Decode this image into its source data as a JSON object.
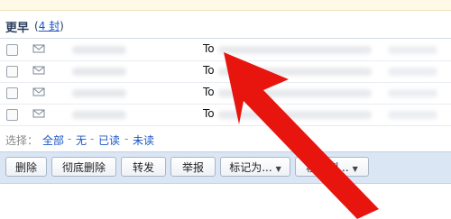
{
  "section": {
    "title": "更早",
    "count_open": "(",
    "count_link": "4 封",
    "count_close": ")"
  },
  "rows": [
    {
      "subject_prefix": "To"
    },
    {
      "subject_prefix": "To"
    },
    {
      "subject_prefix": "To"
    },
    {
      "subject_prefix": "To"
    }
  ],
  "select_bar": {
    "label": "选择：",
    "all": "全部",
    "none": "无",
    "read": "已读",
    "unread": "未读",
    "sep": "-"
  },
  "toolbar": {
    "delete": "删除",
    "delete_permanently": "彻底删除",
    "forward": "转发",
    "report": "举报",
    "mark_as": "标记为...",
    "move_to": "移动到..."
  },
  "colors": {
    "arrow": "#e8150f",
    "toolbar_bg": "#dbe6f4",
    "link": "#1a56c4"
  },
  "icons": {
    "envelope": "envelope-icon",
    "dropdown": "chevron-down-icon",
    "annotation": "red-arrow-annotation"
  }
}
